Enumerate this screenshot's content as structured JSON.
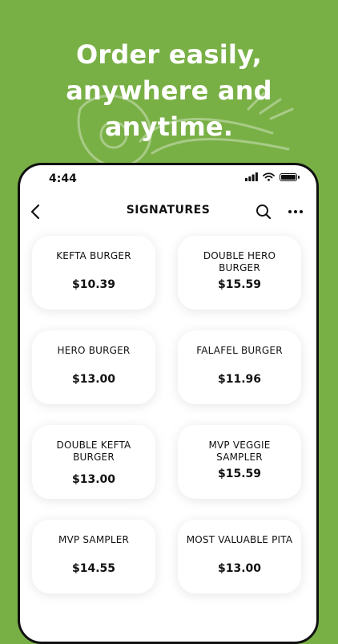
{
  "promo": {
    "line1": "Order easily,",
    "line2": "anywhere and",
    "line3": "anytime."
  },
  "status_bar": {
    "time": "4:44"
  },
  "header": {
    "title": "SIGNATURES",
    "back_icon": "chevron-left-icon",
    "search_icon": "search-icon",
    "more_icon": "more-horizontal-icon"
  },
  "menu_items": [
    {
      "name": "KEFTA BURGER",
      "price": "$10.39"
    },
    {
      "name": "DOUBLE HERO BURGER",
      "price": "$15.59"
    },
    {
      "name": "HERO BURGER",
      "price": "$13.00"
    },
    {
      "name": "FALAFEL BURGER",
      "price": "$11.96"
    },
    {
      "name": "DOUBLE KEFTA BURGER",
      "price": "$13.00"
    },
    {
      "name": "MVP VEGGIE SAMPLER",
      "price": "$15.59"
    },
    {
      "name": "MVP SAMPLER",
      "price": "$14.55"
    },
    {
      "name": "MOST VALUABLE PITA",
      "price": "$13.00"
    }
  ],
  "colors": {
    "background": "#79b046",
    "card": "#ffffff",
    "text": "#111111"
  }
}
